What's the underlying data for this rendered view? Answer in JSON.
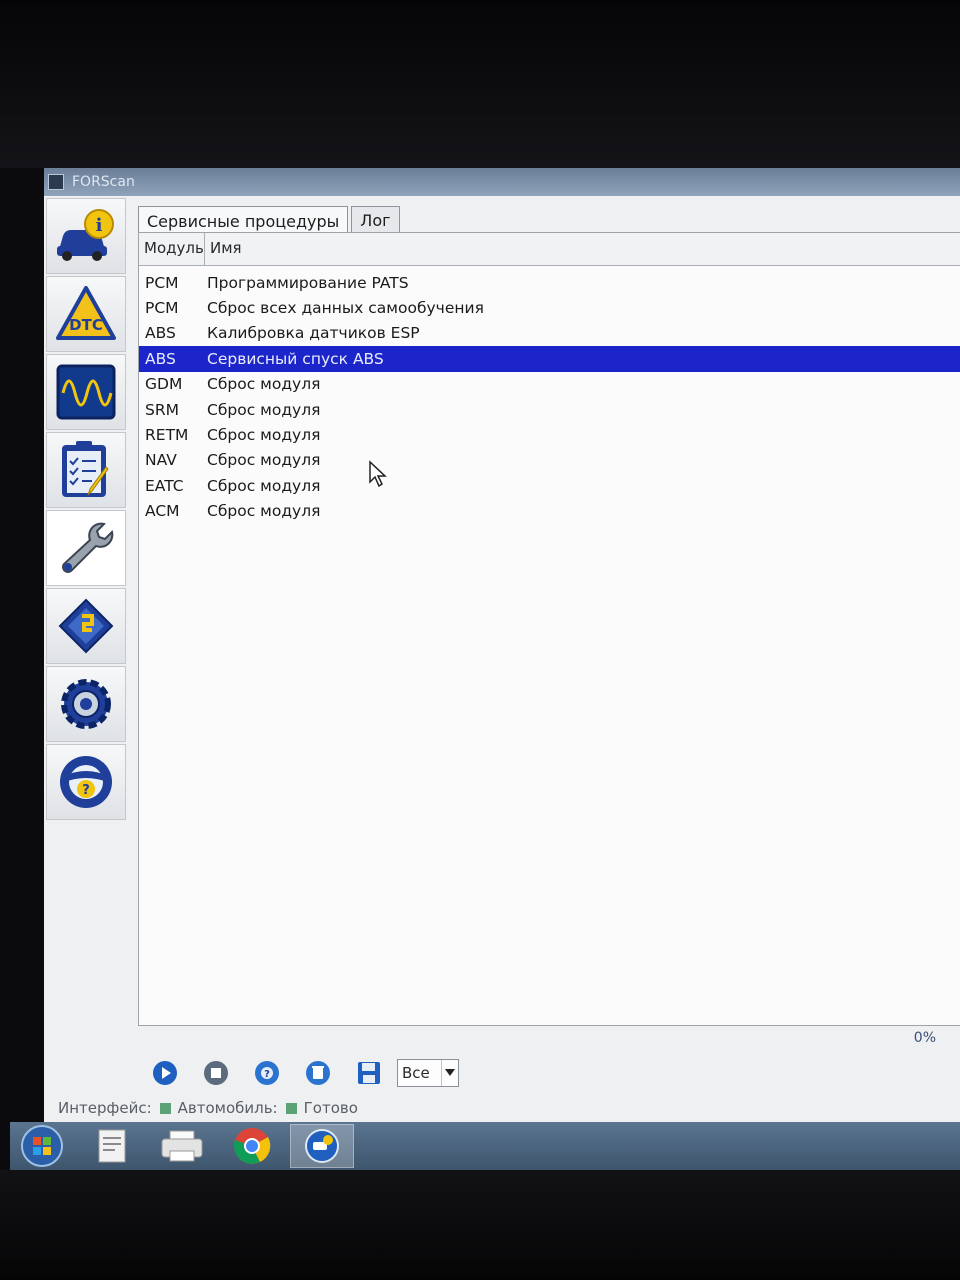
{
  "window": {
    "title": "FORScan"
  },
  "sidebar": {
    "items": [
      {
        "icon": "car-info-icon"
      },
      {
        "icon": "dtc-icon",
        "badge": "DTC"
      },
      {
        "icon": "oscilloscope-icon"
      },
      {
        "icon": "checklist-icon"
      },
      {
        "icon": "wrench-icon"
      },
      {
        "icon": "chip-icon"
      },
      {
        "icon": "gear-icon"
      },
      {
        "icon": "help-steering-icon",
        "badge": "?"
      }
    ]
  },
  "tabs": [
    {
      "label": "Сервисные процедуры",
      "active": true
    },
    {
      "label": "Лог",
      "active": false
    }
  ],
  "table": {
    "columns": [
      "Модуль",
      "Имя"
    ],
    "rows": [
      {
        "module": "PCM",
        "name": "Программирование PATS"
      },
      {
        "module": "PCM",
        "name": "Сброс всех данных самообучения"
      },
      {
        "module": "ABS",
        "name": "Калибровка датчиков ESP"
      },
      {
        "module": "ABS",
        "name": "Сервисный спуск ABS",
        "selected": true
      },
      {
        "module": "GDM",
        "name": "Сброс модуля"
      },
      {
        "module": "SRM",
        "name": "Сброс модуля"
      },
      {
        "module": "RETM",
        "name": "Сброс модуля"
      },
      {
        "module": "NAV",
        "name": "Сброс модуля"
      },
      {
        "module": "EATC",
        "name": "Сброс модуля"
      },
      {
        "module": "ACM",
        "name": "Сброс модуля"
      }
    ]
  },
  "progress": {
    "text": "0%",
    "value": 0
  },
  "toolbar": {
    "buttons": [
      "play-icon",
      "stop-icon",
      "help-icon",
      "clear-icon",
      "save-icon"
    ],
    "filter_value": "Все"
  },
  "statusbar": {
    "interface_label": "Интерфейс:",
    "vehicle_label": "Автомобиль:",
    "ready_label": "Готово",
    "indicator_color": "#5da177"
  },
  "taskbar": {
    "items": [
      "start-icon",
      "document-icon",
      "printer-icon",
      "chrome-icon",
      "forscan-icon"
    ],
    "active_index": 4
  },
  "colors": {
    "selection": "#1c25c9",
    "accent": "#1f3f9a"
  }
}
